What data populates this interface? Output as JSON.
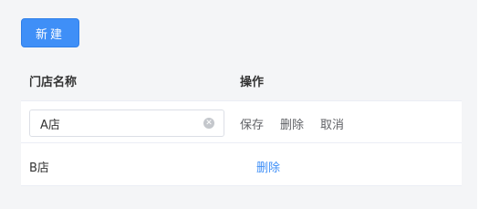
{
  "toolbar": {
    "new_label": "新建"
  },
  "table": {
    "headers": {
      "name": "门店名称",
      "ops": "操作"
    },
    "rows": [
      {
        "editing": true,
        "input_value": "A店",
        "actions": {
          "save": "保存",
          "delete": "删除",
          "cancel": "取消"
        }
      },
      {
        "editing": false,
        "name": "B店",
        "actions": {
          "delete": "删除"
        }
      }
    ]
  },
  "colors": {
    "accent": "#3f8ff7",
    "panel_bg": "#f4f5f7"
  },
  "icons": {
    "clear": "circle-x"
  }
}
